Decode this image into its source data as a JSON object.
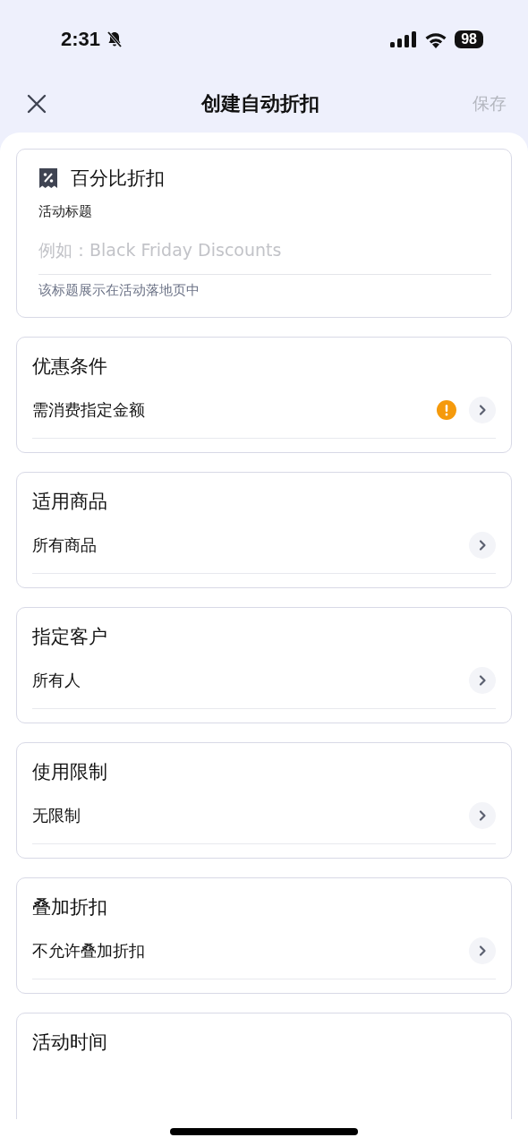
{
  "status_bar": {
    "time": "2:31",
    "silent": true,
    "battery": "98"
  },
  "nav": {
    "title": "创建自动折扣",
    "save": {
      "label": "保存",
      "disabled": true
    }
  },
  "discount_card": {
    "type": "百分比折扣",
    "field_label": "活动标题",
    "placeholder": "例如：Black Friday Discounts",
    "helper": "该标题展示在活动落地页中"
  },
  "sections": [
    {
      "title": "优惠条件",
      "value": "需消费指定金额",
      "warning": true
    },
    {
      "title": "适用商品",
      "value": "所有商品",
      "warning": false
    },
    {
      "title": "指定客户",
      "value": "所有人",
      "warning": false
    },
    {
      "title": "使用限制",
      "value": "无限制",
      "warning": false
    },
    {
      "title": "叠加折扣",
      "value": "不允许叠加折扣",
      "warning": false
    },
    {
      "title": "活动时间"
    }
  ]
}
